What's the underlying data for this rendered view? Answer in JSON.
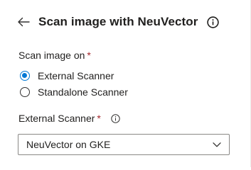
{
  "header": {
    "title": "Scan image with NeuVector",
    "back_icon": "back-arrow-icon",
    "info_icon": "info-icon"
  },
  "scan_target": {
    "label": "Scan image on",
    "required_mark": "*",
    "options": [
      {
        "label": "External Scanner",
        "selected": true
      },
      {
        "label": "Standalone Scanner",
        "selected": false
      }
    ]
  },
  "external_scanner": {
    "label": "External Scanner",
    "required_mark": "*",
    "info_icon": "info-icon",
    "selected_value": "NeuVector on GKE",
    "dropdown_icon": "chevron-down-icon"
  },
  "colors": {
    "accent": "#0078d4",
    "required": "#a4262c",
    "text": "#201f1e",
    "border": "#8a8886"
  }
}
